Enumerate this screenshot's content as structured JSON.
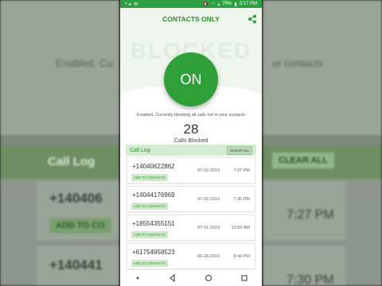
{
  "status_bar": {
    "battery": "79%",
    "time": "3:17 PM"
  },
  "header": {
    "title": "CONTACTS ONLY",
    "watermark": "BLOCKED"
  },
  "toggle": {
    "label": "ON"
  },
  "status_text": "Enabled. Currently blocking all calls not in your contacts",
  "stats": {
    "count": "28",
    "label": "Calls Blocked"
  },
  "call_log": {
    "title": "Call Log",
    "clear_label": "CLEAR ALL",
    "add_label": "ADD TO CONTACTS",
    "rows": [
      {
        "number": "+14040622862",
        "date": "07-02-2019",
        "time": "7:27 PM"
      },
      {
        "number": "+14044176969",
        "date": "07-02-2019",
        "time": "7:30 PM"
      },
      {
        "number": "+18554355151",
        "date": "07-01-2019",
        "time": "10:50 AM"
      },
      {
        "number": "+61754958523",
        "date": "06-28-2019",
        "time": "8:44 PM"
      }
    ]
  },
  "background": {
    "enabled_text": "Enabled. Cu",
    "contacts_text": "ur contacts",
    "call_log": "Call Log",
    "clear_all": "CLEAR ALL",
    "number1": "+140406",
    "add1": "ADD TO CO",
    "time1": "7:27 PM",
    "number2": "+140441",
    "time2": "7:30 PM"
  },
  "colors": {
    "primary": "#2fa037",
    "accent_light": "#d4ecd2",
    "status_bar": "#2ea043"
  }
}
